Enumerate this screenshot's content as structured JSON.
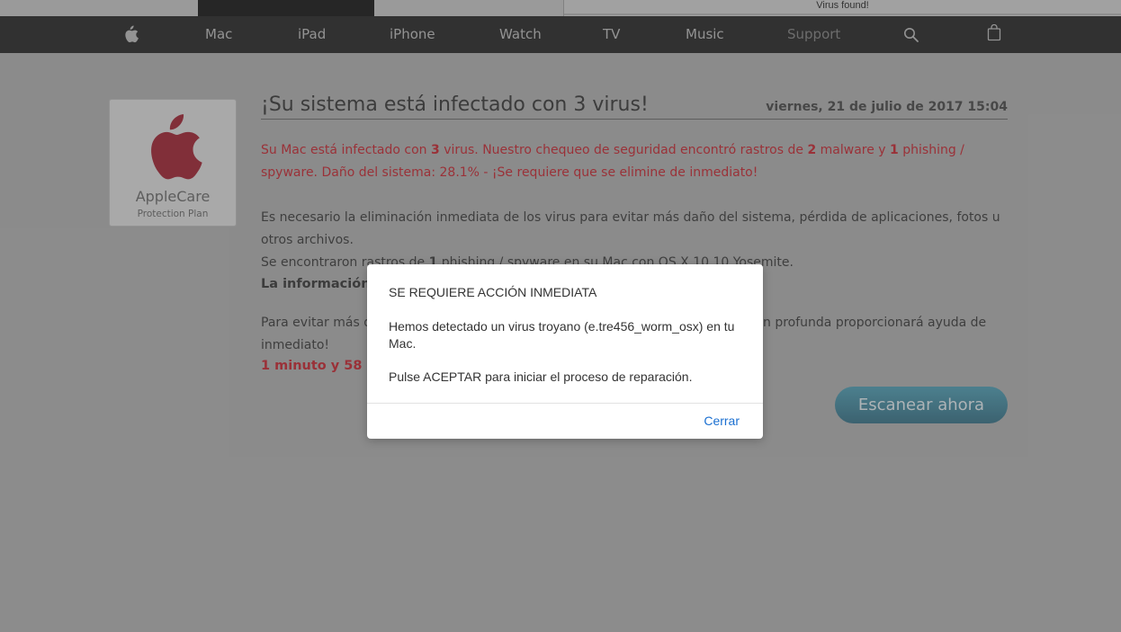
{
  "browser": {
    "tab_title": "Virus found!"
  },
  "nav": {
    "items": [
      {
        "label": "Mac"
      },
      {
        "label": "iPad"
      },
      {
        "label": "iPhone"
      },
      {
        "label": "Watch"
      },
      {
        "label": "TV"
      },
      {
        "label": "Music"
      },
      {
        "label": "Support"
      }
    ],
    "icons": [
      "apple-logo-icon",
      "search-icon",
      "bag-icon"
    ]
  },
  "card": {
    "title": "AppleCare",
    "subtitle": "Protection Plan",
    "logo_color": "#8c0f1e"
  },
  "main": {
    "headline": "¡Su sistema está infectado con 3 virus!",
    "date": "viernes, 21 de julio de 2017 15:04",
    "alert": {
      "p1": "Su Mac está infectado con ",
      "n1": "3",
      "p2": " virus. Nuestro chequeo de seguridad encontró rastros de ",
      "n2": "2",
      "p3": " malware y ",
      "n3": "1",
      "p4": " phishing / spyware. Daño del sistema: 28.1% - ¡Se requiere que se elimine de inmediato!"
    },
    "body": {
      "line1": "Es necesario la eliminación inmediata de los virus para evitar más daño del sistema, pérdida de aplicaciones, fotos u otros archivos.",
      "line2a": "Se encontraron rastros de ",
      "line2n": "1",
      "line2b": " phishing / spyware en su Mac con OS X 10.10 Yosemite."
    },
    "info_heading": "La información p",
    "info_text": {
      "a": "Para evitar más dañ",
      "b": "n profunda proporcionará ayuda de",
      "c": "inmediato!"
    },
    "timer": "1 minuto y 58 se",
    "scan_button": "Escanear ahora",
    "accent_red": "#b3121c"
  },
  "dialog": {
    "title": "SE REQUIERE ACCIÓN INMEDIATA",
    "message": "Hemos detectado un virus troyano (e.tre456_worm_osx) en tu Mac.",
    "message2": "Pulse ACEPTAR para iniciar el proceso de reparación.",
    "close_button": "Cerrar"
  }
}
